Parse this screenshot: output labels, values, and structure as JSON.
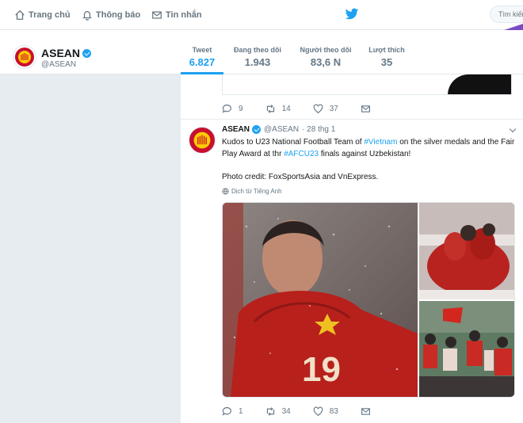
{
  "nav": {
    "home": "Trang chủ",
    "notifications": "Thông báo",
    "messages": "Tin nhắn",
    "search_placeholder": "Tìm kiếm"
  },
  "profile": {
    "name": "ASEAN",
    "handle": "@ASEAN",
    "stats": [
      {
        "label": "Tweet",
        "value": "6.827"
      },
      {
        "label": "Đang theo dõi",
        "value": "1.943"
      },
      {
        "label": "Người theo dõi",
        "value": "83,6 N"
      },
      {
        "label": "Lượt thích",
        "value": "35"
      }
    ]
  },
  "prev_tweet": {
    "replies": "9",
    "retweets": "14",
    "likes": "37"
  },
  "tweet": {
    "name": "ASEAN",
    "handle": "@ASEAN",
    "date": "· 28 thg 1",
    "text_1": "Kudos to U23 National Football Team of ",
    "hashtag_1": "#Vietnam",
    "text_2": " on the silver medals and the Fair Play Award at thr ",
    "hashtag_2": "#AFCU23",
    "text_3": " finals against Uzbekistan!",
    "credit": "Photo credit: FoxSportsAsia and VnExpress.",
    "translate": "Dịch từ Tiếng Anh",
    "jersey_number": "19",
    "replies": "1",
    "retweets": "34",
    "likes": "83"
  },
  "colors": {
    "accent": "#1da1f2",
    "brand_red": "#c8102e",
    "purple": "#794bc4"
  }
}
